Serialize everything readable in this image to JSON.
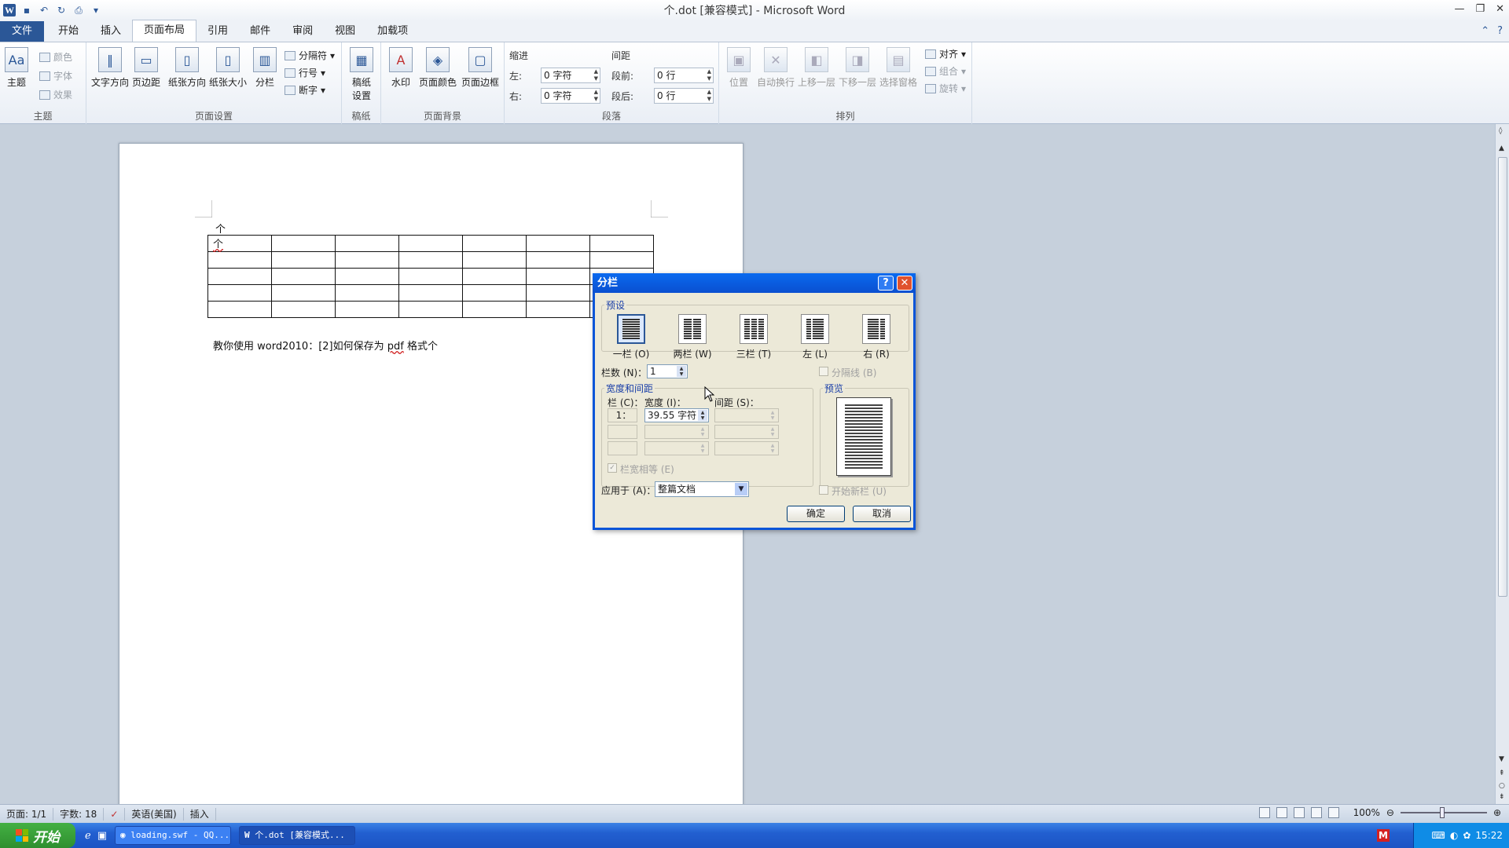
{
  "window": {
    "title": "个.dot [兼容模式] - Microsoft Word"
  },
  "tabs": [
    {
      "label": "文件"
    },
    {
      "label": "开始"
    },
    {
      "label": "插入"
    },
    {
      "label": "页面布局"
    },
    {
      "label": "引用"
    },
    {
      "label": "邮件"
    },
    {
      "label": "审阅"
    },
    {
      "label": "视图"
    },
    {
      "label": "加载项"
    }
  ],
  "ribbon": {
    "theme": {
      "themes": "主题",
      "colors": "颜色",
      "fonts": "字体",
      "effects": "效果",
      "label": "主题"
    },
    "page_setup": {
      "text_direction": "文字方向",
      "margins": "页边距",
      "orientation": "纸张方向",
      "size": "纸张大小",
      "columns": "分栏",
      "breaks": "分隔符",
      "line_numbers": "行号",
      "hyphenation": "断字",
      "label": "页面设置"
    },
    "manuscript": {
      "settings_1": "稿纸",
      "settings_2": "设置",
      "label": "稿纸"
    },
    "page_background": {
      "watermark": "水印",
      "page_color": "页面颜色",
      "page_borders": "页面边框",
      "label": "页面背景"
    },
    "paragraph": {
      "indent": "缩进",
      "spacing": "间距",
      "left": "左:",
      "right": "右:",
      "before": "段前:",
      "after": "段后:",
      "left_value": "0 字符",
      "right_value": "0 字符",
      "before_value": "0 行",
      "after_value": "0 行",
      "label": "段落"
    },
    "arrange": {
      "position": "位置",
      "wrap": "自动换行",
      "bring_forward": "上移一层",
      "send_backward": "下移一层",
      "selection_pane": "选择窗格",
      "align": "对齐",
      "group": "组合",
      "rotate": "旋转",
      "label": "排列"
    }
  },
  "document": {
    "line1": "个",
    "cell1": "个",
    "caption_a": "教你使用 ",
    "caption_b": "word2010",
    "caption_c": "：[2]如何保存为 ",
    "caption_d": "pdf",
    "caption_e": " 格式个"
  },
  "dialog": {
    "title": "分栏",
    "help": "?",
    "close": "✕",
    "presets_legend": "预设",
    "presets": [
      {
        "label": "一栏 (O)",
        "cols": 1
      },
      {
        "label": "两栏 (W)",
        "cols": 2
      },
      {
        "label": "三栏 (T)",
        "cols": 3
      },
      {
        "label": "左 (L)",
        "cols": 2
      },
      {
        "label": "右 (R)",
        "cols": 2
      }
    ],
    "num_cols_label": "栏数 (N)：",
    "num_cols_value": "1",
    "separator_label": "分隔线 (B)",
    "width_spacing_legend": "宽度和间距",
    "preview_legend": "预览",
    "col_header": "栏 (C)：",
    "width_header": "宽度 (I)：",
    "spacing_header": "间距 (S)：",
    "row1_col": "1：",
    "row1_width": "39.55 字符",
    "equal_width_label": "栏宽相等 (E)",
    "apply_to_label": "应用于 (A)：",
    "apply_to_value": "整篇文档",
    "new_column_label": "开始新栏 (U)",
    "ok": "确定",
    "cancel": "取消"
  },
  "statusbar": {
    "page": "页面: 1/1",
    "words": "字数: 18",
    "language": "英语(美国)",
    "mode": "插入",
    "zoom": "100%"
  },
  "taskbar": {
    "start": "开始",
    "task1": "loading.swf - QQ...",
    "task2": "个.dot [兼容模式...",
    "time": "15:22"
  }
}
